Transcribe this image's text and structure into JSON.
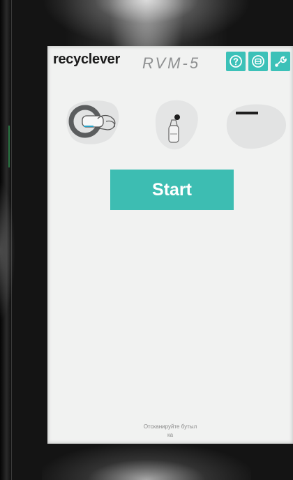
{
  "header": {
    "brand": "recyclever",
    "model": "RVM-5",
    "icons": [
      "help-icon",
      "settings-icon",
      "service-wrench-icon"
    ]
  },
  "steps": [
    {
      "name": "insert-bottle-step",
      "icon": "bottle-in-hand-icon"
    },
    {
      "name": "bottle-upright-step",
      "icon": "bottle-icon"
    },
    {
      "name": "status-step",
      "icon": "dash-icon"
    }
  ],
  "main": {
    "start_label": "Start"
  },
  "footer": {
    "line1": "Отсканируйте бутыл",
    "line2": "ка"
  },
  "colors": {
    "accent": "#3dbdb2",
    "screen_bg": "#f1f2f1",
    "brand_text": "#1c1c1c",
    "model_text": "#8e9091"
  }
}
